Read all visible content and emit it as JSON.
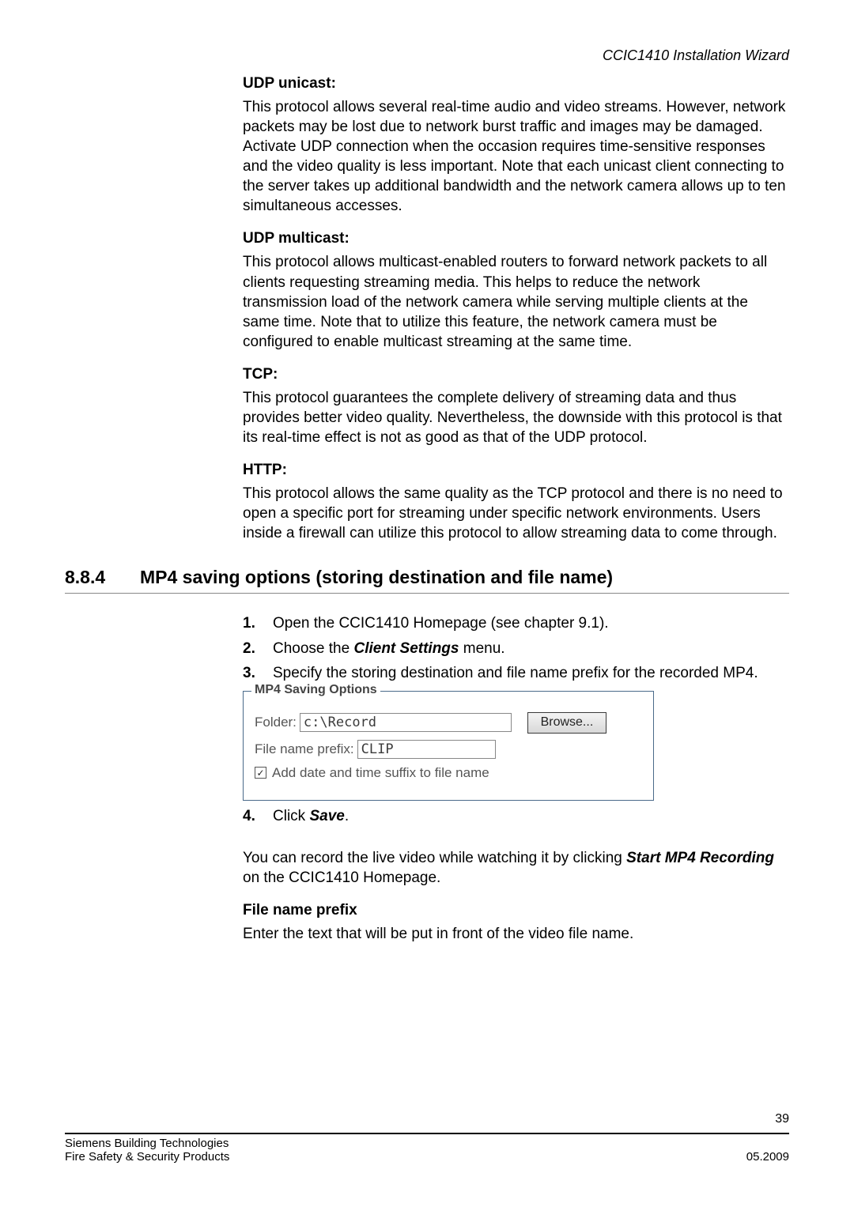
{
  "running_title": "CCIC1410 Installation Wizard",
  "udp_unicast": {
    "heading": "UDP unicast:",
    "body": "This protocol allows several real-time audio and video streams. However, network packets may be lost due to network burst traffic and images may be damaged. Activate UDP connection when the occasion requires time-sensitive responses and the video quality is less important. Note that each unicast client connecting to the server takes up additional bandwidth and the network camera allows up to ten simultaneous accesses."
  },
  "udp_multicast": {
    "heading": "UDP multicast:",
    "body": "This protocol allows multicast-enabled routers to forward network packets to all clients requesting streaming media. This helps to reduce the network transmission load of the network camera while serving multiple clients at the same time. Note that to utilize this feature, the network camera must be configured to enable multicast streaming at the same time."
  },
  "tcp": {
    "heading": "TCP:",
    "body": "This protocol guarantees the complete delivery of streaming data and thus provides better video quality. Nevertheless, the downside with this protocol is that its real-time effect is not as good as that of the UDP protocol."
  },
  "http": {
    "heading": "HTTP:",
    "body": "This protocol allows the same quality as the TCP protocol and there is no need to open a specific port for streaming under specific network environments. Users inside a firewall can utilize this protocol to allow streaming data to come through."
  },
  "section": {
    "number": "8.8.4",
    "title": "MP4 saving options (storing destination and file name)"
  },
  "steps": {
    "s1_num": "1.",
    "s1_text_a": "Open the CCIC1410 Homepage (see chapter 9.1).",
    "s2_num": "2.",
    "s2_text_a": "Choose the ",
    "s2_text_b": "Client Settings",
    "s2_text_c": " menu.",
    "s3_num": "3.",
    "s3_text_a": "Specify the storing destination and file name prefix for the recorded MP4.",
    "s4_num": "4.",
    "s4_text_a": "Click ",
    "s4_text_b": "Save",
    "s4_text_c": "."
  },
  "mp4": {
    "legend": "MP4 Saving Options",
    "folder_label": "Folder:",
    "folder_value": "c:\\Record",
    "browse": "Browse...",
    "prefix_label": "File name prefix:",
    "prefix_value": "CLIP",
    "checkbox_label": "Add date and time suffix to file name",
    "check_mark": "✓"
  },
  "post": {
    "you_can_a": "You can record the live video while watching it by clicking ",
    "you_can_b": "Start MP4 Recording",
    "you_can_c": " on the CCIC1410 Homepage.",
    "fileprefix_h": "File name prefix",
    "fileprefix_b": "Enter the text that will be put in front of the video file name."
  },
  "footer": {
    "page_num": "39",
    "left1": "Siemens Building Technologies",
    "left2": "Fire Safety & Security Products",
    "right2": "05.2009"
  }
}
